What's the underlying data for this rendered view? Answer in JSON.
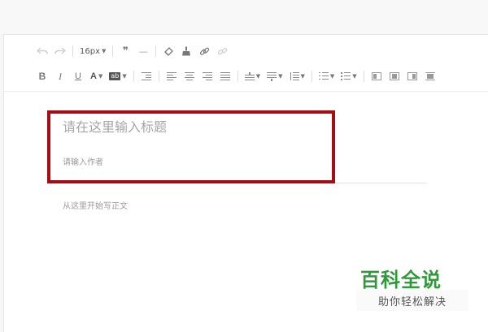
{
  "toolbar": {
    "undo_icon": "undo-icon",
    "redo_icon": "redo-icon",
    "font_size": "16px",
    "quote_glyph": "❞",
    "hr_glyph": "—",
    "bold_label": "B",
    "italic_label": "I",
    "underline_label": "U",
    "font_color_label": "A",
    "bg_color_label": "ab"
  },
  "editor": {
    "title_placeholder": "请在这里输入标题",
    "author_placeholder": "请输入作者",
    "body_placeholder": "从这里开始写正文"
  },
  "watermark": {
    "title": "百科全说",
    "subtitle": "助你轻松解决"
  },
  "colors": {
    "highlight": "#a80c10",
    "watermark_green": "#2f9a3a"
  }
}
